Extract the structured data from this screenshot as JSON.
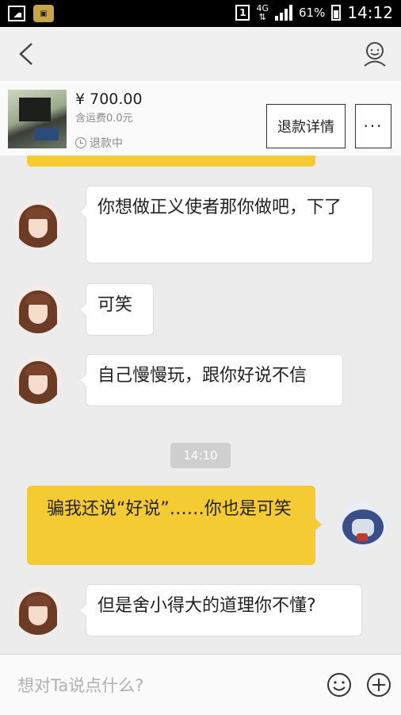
{
  "status_bar": {
    "sim_slot": "1",
    "network": "4G",
    "battery": "61%",
    "time": "14:12"
  },
  "order": {
    "price": "¥ 700.00",
    "shipping": "含运费0.0元",
    "status": "退款中",
    "refund_details_label": "退款详情",
    "more_label": "···"
  },
  "messages": [
    {
      "side": "left",
      "text": "你想做正义使者那你做吧，下了"
    },
    {
      "side": "left",
      "text": "可笑"
    },
    {
      "side": "left",
      "text": "自己慢慢玩，跟你好说不信"
    },
    {
      "side": "right",
      "text": "骗我还说“好说”……你也是可笑"
    },
    {
      "side": "left",
      "text": "但是舍小得大的道理你不懂?"
    }
  ],
  "timestamp": "14:10",
  "input": {
    "placeholder": "想对Ta说点什么?"
  },
  "colors": {
    "accent_bubble": "#f5cb33",
    "background": "#ececec"
  }
}
